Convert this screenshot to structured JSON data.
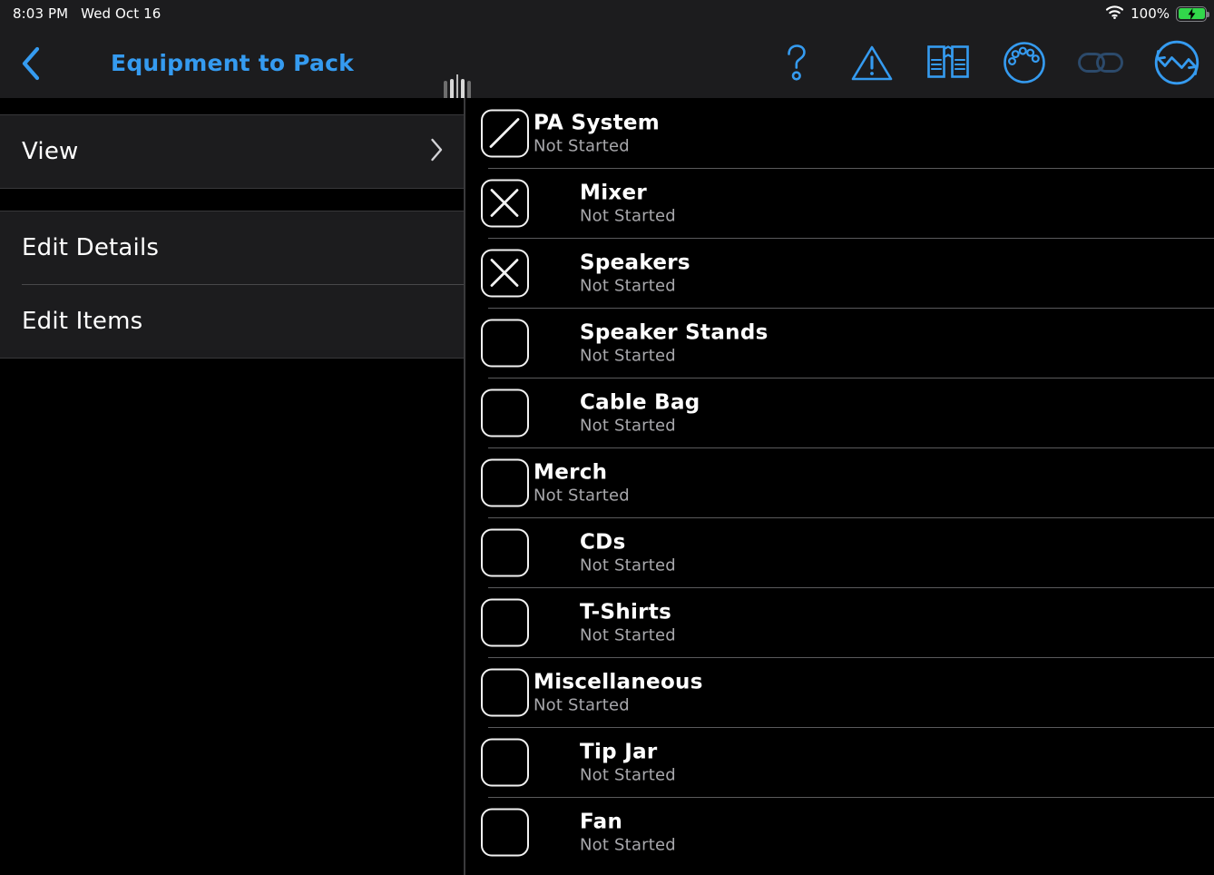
{
  "status_bar": {
    "time": "8:03 PM",
    "date": "Wed Oct 16",
    "battery_percent": "100%",
    "wifi_icon": "wifi-icon",
    "battery_icon": "battery-charging-icon"
  },
  "nav": {
    "back_icon": "chevron-left-icon",
    "title": "Equipment to Pack",
    "split_handle_icon": "split-view-drag-handle-icon",
    "icons": [
      {
        "name": "help-icon",
        "glyph": "question-mark",
        "enabled": true
      },
      {
        "name": "warning-icon",
        "glyph": "warning-triangle",
        "enabled": true
      },
      {
        "name": "book-icon",
        "glyph": "open-book",
        "enabled": true
      },
      {
        "name": "gauge-icon",
        "glyph": "circle-with-dots",
        "enabled": true
      },
      {
        "name": "link-icon",
        "glyph": "chain-link",
        "enabled": false
      },
      {
        "name": "sync-icon",
        "glyph": "circular-sync-wave",
        "enabled": true
      }
    ]
  },
  "sidebar": {
    "groups": [
      {
        "rows": [
          {
            "label": "View",
            "chevron": true
          }
        ]
      },
      {
        "rows": [
          {
            "label": "Edit Details",
            "chevron": false
          },
          {
            "label": "Edit Items",
            "chevron": false
          }
        ]
      }
    ]
  },
  "list": {
    "status_default": "Not Started",
    "items": [
      {
        "title": "PA System",
        "status": "Not Started",
        "level": 0,
        "check": "slash"
      },
      {
        "title": "Mixer",
        "status": "Not Started",
        "level": 1,
        "check": "x"
      },
      {
        "title": "Speakers",
        "status": "Not Started",
        "level": 1,
        "check": "x"
      },
      {
        "title": "Speaker Stands",
        "status": "Not Started",
        "level": 1,
        "check": "empty"
      },
      {
        "title": "Cable Bag",
        "status": "Not Started",
        "level": 1,
        "check": "empty"
      },
      {
        "title": "Merch",
        "status": "Not Started",
        "level": 0,
        "check": "empty"
      },
      {
        "title": "CDs",
        "status": "Not Started",
        "level": 1,
        "check": "empty"
      },
      {
        "title": "T-Shirts",
        "status": "Not Started",
        "level": 1,
        "check": "empty"
      },
      {
        "title": "Miscellaneous",
        "status": "Not Started",
        "level": 0,
        "check": "empty"
      },
      {
        "title": "Tip Jar",
        "status": "Not Started",
        "level": 1,
        "check": "empty"
      },
      {
        "title": "Fan",
        "status": "Not Started",
        "level": 1,
        "check": "empty"
      }
    ]
  },
  "colors": {
    "accent_blue": "#359bf0",
    "dim_blue": "#2c4a6b",
    "battery_green": "#32d74b",
    "panel_bg": "#1c1c1e",
    "page_bg": "#000000",
    "separator": "#5a5a5c",
    "subtitle_gray": "#a8a8ac"
  }
}
